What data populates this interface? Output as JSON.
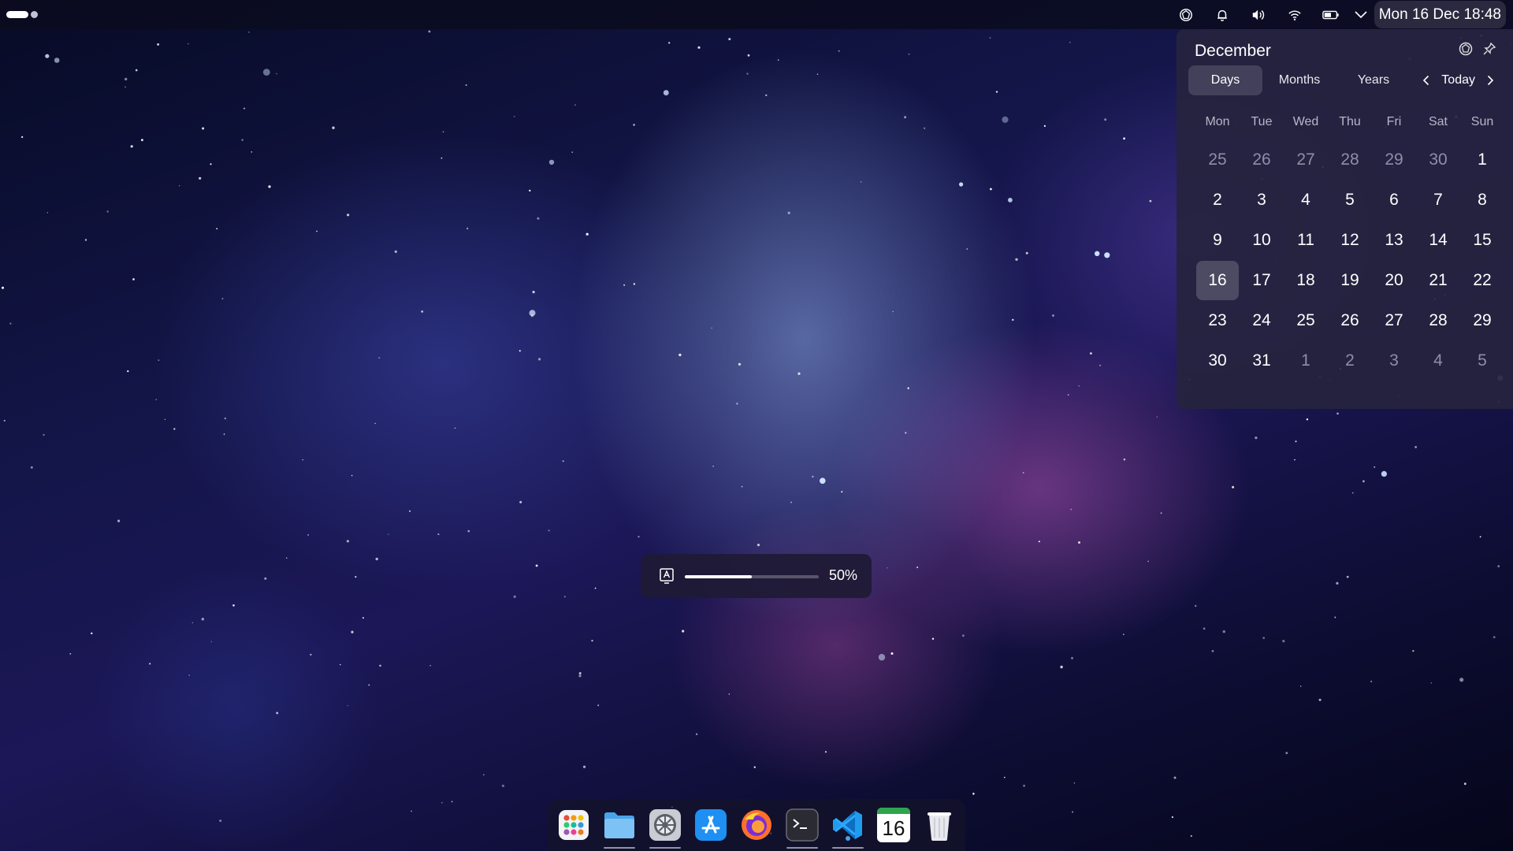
{
  "topbar": {
    "clock": "Mon 16 Dec 18:48",
    "tray_icons": [
      "vpn-icon",
      "notifications-icon",
      "volume-icon",
      "wifi-icon",
      "battery-icon",
      "menu-chevron-icon"
    ]
  },
  "calendar": {
    "month_title": "December",
    "tabs": [
      {
        "label": "Days",
        "active": true
      },
      {
        "label": "Months",
        "active": false
      },
      {
        "label": "Years",
        "active": false
      }
    ],
    "today_label": "Today",
    "weekdays": [
      "Mon",
      "Tue",
      "Wed",
      "Thu",
      "Fri",
      "Sat",
      "Sun"
    ],
    "weeks": [
      [
        {
          "d": "25",
          "muted": true
        },
        {
          "d": "26",
          "muted": true
        },
        {
          "d": "27",
          "muted": true
        },
        {
          "d": "28",
          "muted": true
        },
        {
          "d": "29",
          "muted": true
        },
        {
          "d": "30",
          "muted": true
        },
        {
          "d": "1"
        }
      ],
      [
        {
          "d": "2"
        },
        {
          "d": "3"
        },
        {
          "d": "4"
        },
        {
          "d": "5"
        },
        {
          "d": "6"
        },
        {
          "d": "7"
        },
        {
          "d": "8"
        }
      ],
      [
        {
          "d": "9"
        },
        {
          "d": "10"
        },
        {
          "d": "11"
        },
        {
          "d": "12"
        },
        {
          "d": "13"
        },
        {
          "d": "14"
        },
        {
          "d": "15"
        }
      ],
      [
        {
          "d": "16",
          "today": true
        },
        {
          "d": "17"
        },
        {
          "d": "18"
        },
        {
          "d": "19"
        },
        {
          "d": "20"
        },
        {
          "d": "21"
        },
        {
          "d": "22"
        }
      ],
      [
        {
          "d": "23"
        },
        {
          "d": "24"
        },
        {
          "d": "25"
        },
        {
          "d": "26"
        },
        {
          "d": "27"
        },
        {
          "d": "28"
        },
        {
          "d": "29"
        }
      ],
      [
        {
          "d": "30"
        },
        {
          "d": "31"
        },
        {
          "d": "1",
          "muted": true
        },
        {
          "d": "2",
          "muted": true
        },
        {
          "d": "3",
          "muted": true
        },
        {
          "d": "4",
          "muted": true
        },
        {
          "d": "5",
          "muted": true
        }
      ]
    ]
  },
  "osd": {
    "value_label": "50%",
    "level": 0.5
  },
  "dock": {
    "items": [
      "app-grid-icon",
      "files-icon",
      "settings-icon",
      "app-store-icon",
      "firefox-icon",
      "terminal-icon",
      "vscode-icon",
      "calendar-app-icon",
      "trash-icon"
    ],
    "calendar_day": "16"
  },
  "colors": {
    "accent": "#ffffff",
    "panel": "#26243e",
    "calendar_band": "#2ea44f"
  }
}
